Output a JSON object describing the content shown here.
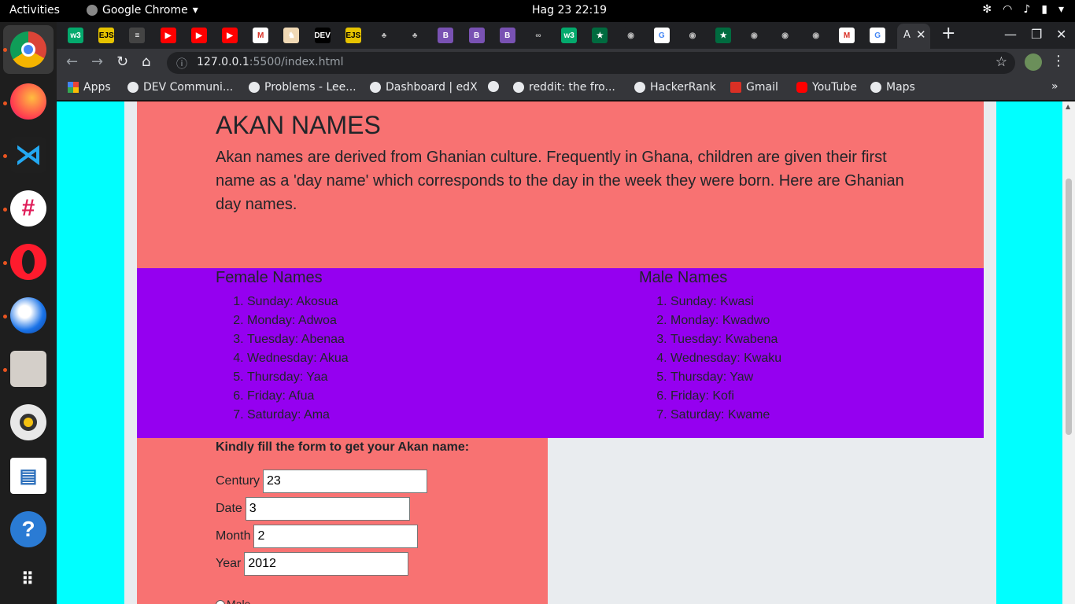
{
  "system_bar": {
    "activities": "Activities",
    "app_name": "Google Chrome",
    "clock": "Hag 23  22:19"
  },
  "dock": {
    "apps": [
      "chrome-icon",
      "firefox-icon",
      "vscode-icon",
      "slack-icon",
      "opera-icon",
      "thunderbird-icon",
      "files-icon",
      "rhythmbox-icon",
      "writer-icon",
      "help-icon",
      "show-apps-icon"
    ]
  },
  "tabs": {
    "favicons": [
      "w3",
      "EJS",
      "list",
      "yt",
      "yt",
      "yt",
      "M",
      "fox",
      "DEV",
      "EJS",
      "palm",
      "palm",
      "B",
      "B",
      "B",
      "cloud",
      "w3",
      "gh-flag",
      "gh",
      "G",
      "gh",
      "gh-flag",
      "gh",
      "gh",
      "gh",
      "M",
      "G"
    ],
    "active_title": "A"
  },
  "toolbar": {
    "url_host": "127.0.0.1",
    "url_rest": ":5500/index.html"
  },
  "bookmarks": [
    {
      "label": "Apps",
      "icon": "apps-grid-icon"
    },
    {
      "label": "DEV Communi...",
      "icon": "globe-icon"
    },
    {
      "label": "Problems - Lee...",
      "icon": "globe-icon"
    },
    {
      "label": "Dashboard | edX",
      "icon": "globe-icon"
    },
    {
      "label": "",
      "icon": "globe-icon"
    },
    {
      "label": "reddit: the fro...",
      "icon": "globe-icon"
    },
    {
      "label": "HackerRank",
      "icon": "globe-icon"
    },
    {
      "label": "Gmail",
      "icon": "gmail-icon"
    },
    {
      "label": "YouTube",
      "icon": "youtube-icon"
    },
    {
      "label": "Maps",
      "icon": "globe-icon"
    }
  ],
  "page": {
    "title": "AKAN NAMES",
    "intro": "Akan names are derived from Ghanian culture. Frequently in Ghana, children are given their first name as a 'day name' which corresponds to the day in the week they were born. Here are Ghanian day names.",
    "female": {
      "heading": "Female Names",
      "items": [
        "Sunday: Akosua",
        "Monday: Adwoa",
        "Tuesday: Abenaa",
        "Wednesday: Akua",
        "Thursday: Yaa",
        "Friday: Afua",
        "Saturday: Ama"
      ]
    },
    "male": {
      "heading": "Male Names",
      "items": [
        "Sunday: Kwasi",
        "Monday: Kwadwo",
        "Tuesday: Kwabena",
        "Wednesday: Kwaku",
        "Thursday: Yaw",
        "Friday: Kofi",
        "Saturday: Kwame"
      ]
    },
    "form": {
      "lead": "Kindly fill the form to get your Akan name:",
      "fields": [
        {
          "label": "Century",
          "value": "23"
        },
        {
          "label": "Date",
          "value": "3"
        },
        {
          "label": "Month",
          "value": "2"
        },
        {
          "label": "Year",
          "value": "2012"
        }
      ],
      "radio_peek": "Male"
    }
  },
  "colors": {
    "cyan_bg": "#00ffff",
    "salmon": "#f87272",
    "purple": "#9500f0",
    "grey_page": "#e9ecef"
  }
}
